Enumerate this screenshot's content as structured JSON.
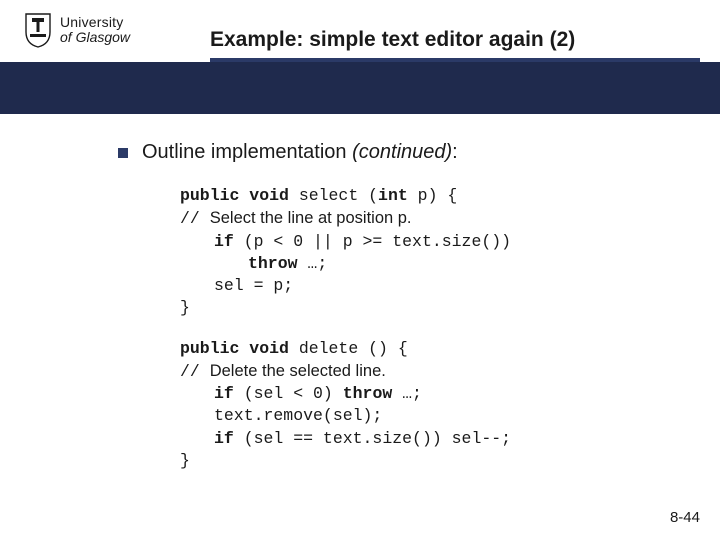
{
  "logo": {
    "line1": "University",
    "line2_prefix": "of",
    "line2_name": "Glasgow"
  },
  "title": "Example: simple text editor again (2)",
  "bullet": {
    "prefix": "Outline implementation ",
    "italic_part": "(continued)",
    "suffix": ":"
  },
  "code": {
    "select": {
      "sig_pre": "public void",
      "sig_mid": " select (",
      "sig_kw2": "int",
      "sig_post": " p) {",
      "comment_slashes": "//  ",
      "comment_text": "Select the line at position p.",
      "l1_kw": "if",
      "l1_rest": " (p < 0 || p >= text.size())",
      "l2_kw": "throw",
      "l2_rest": " …;",
      "l3": "sel = p;",
      "close": "}"
    },
    "delete": {
      "sig_pre": "public void",
      "sig_mid": " delete () {",
      "comment_slashes": "//  ",
      "comment_text": "Delete the selected line.",
      "l1_kw": "if",
      "l1_mid": " (sel < 0) ",
      "l1_kw2": "throw",
      "l1_rest": " …;",
      "l2": "text.remove(sel);",
      "l3_kw": "if",
      "l3_rest": " (sel == text.size()) sel--;",
      "close": "}"
    }
  },
  "page_number": "8-44"
}
